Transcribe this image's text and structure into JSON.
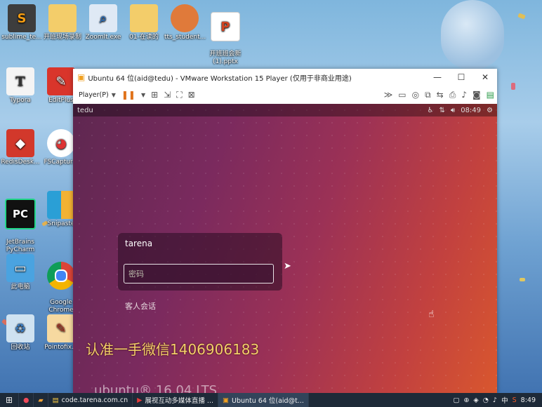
{
  "desktop": {
    "top_row": [
      "sublime_te...",
      "开班现场录制",
      "ZoomIt.exe",
      "01-在读的",
      "tts_student...",
      "开班班会新\n(1).pptx"
    ],
    "left_col": [
      "Typora",
      "RedisDesk...",
      "JetBrains\nPyCharm C...",
      "此电脑",
      "回收站"
    ],
    "second_col": [
      "EditPlus",
      "FSCaptur...",
      "Snipaste",
      "Google\nChrome",
      "Pointofix..."
    ]
  },
  "vmware": {
    "window_title": "Ubuntu 64 位(aid@tedu) - VMware Workstation 15 Player (仅用于非商业用途)",
    "player_menu": "Player(P)",
    "host_name": "tedu",
    "clock": "08:49",
    "login_user": "tarena",
    "password_placeholder": "密码",
    "guest_session": "客人会话",
    "ubuntu_version": "ubuntu® 16.04 LTS"
  },
  "overlay_text": "认准一手微信1406906183",
  "taskbar": {
    "tasks": [
      "code.tarena.com.cn",
      "展视互动多媒体直播 ...",
      "Ubuntu 64 位(aid@t..."
    ],
    "ime": "中",
    "time": "8:49"
  },
  "colors": {
    "ubuntu_purple": "#5e2750",
    "ubuntu_orange": "#d9572e",
    "watermark": "#f2d06a"
  }
}
